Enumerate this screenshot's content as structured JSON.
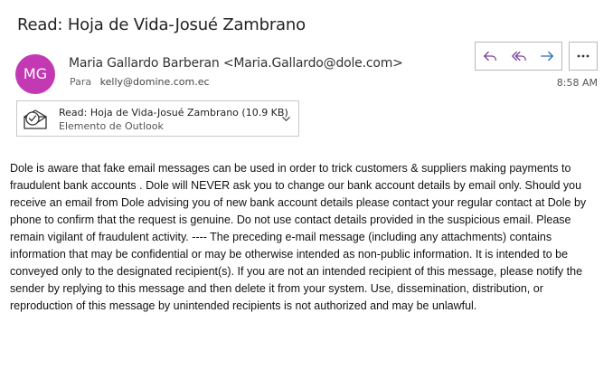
{
  "message": {
    "subject": "Read: Hoja de Vida-Josué Zambrano",
    "sender_initials": "MG",
    "sender": "Maria Gallardo Barberan <Maria.Gallardo@dole.com>",
    "to_label": "Para",
    "to": "kelly@domine.com.ec",
    "time": "8:58 AM"
  },
  "actions": {
    "reply": "reply-icon",
    "reply_all": "reply-all-icon",
    "forward": "forward-icon",
    "more": "more-options-icon"
  },
  "attachment": {
    "name": "Read: Hoja de Vida-Josué Zambrano (10.9 KB)",
    "type": "Elemento de Outlook",
    "icon": "outlook-item-icon"
  },
  "body": "Dole is aware that fake email messages can be used in order to trick customers & suppliers making payments to fraudulent bank accounts . Dole will NEVER ask you to change our bank account details by email only. Should you receive an email from Dole advising you of new bank account details please contact your regular contact at Dole by phone to confirm that the request is genuine. Do not use contact details provided in the suspicious email. Please remain vigilant of fraudulent activity. ---- The preceding e-mail message (including any attachments) contains information that may be confidential or may be otherwise intended as non-public information. It is intended to be conveyed only to the designated recipient(s). If you are not an intended recipient of this message, please notify the sender by replying to this message and then delete it from your system. Use, dissemination, distribution, or reproduction of this message by unintended recipients is not authorized and may be unlawful.",
  "colors": {
    "avatar_bg": "#c239b3",
    "action_icon": "#7a3f9d",
    "forward_icon": "#2b6cb8"
  }
}
